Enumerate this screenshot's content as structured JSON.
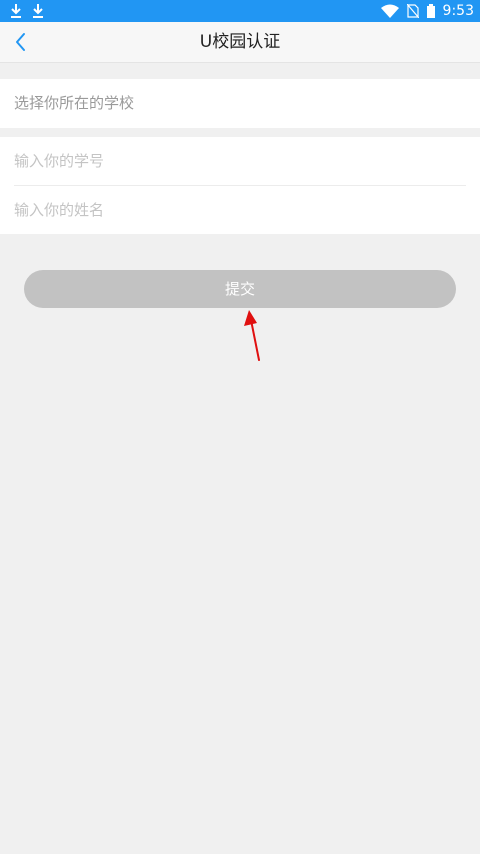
{
  "status_bar": {
    "time": "9:53",
    "background_color": "#2196f3",
    "left_icons": [
      "download-icon",
      "download-icon"
    ],
    "right_icons": [
      "wifi-icon",
      "no-sim-icon",
      "battery-icon"
    ]
  },
  "nav": {
    "back_icon": "chevron-left-icon",
    "title": "U校园认证"
  },
  "form": {
    "school_select_label": "选择你所在的学校",
    "student_id_placeholder": "输入你的学号",
    "student_id_value": "",
    "name_placeholder": "输入你的姓名",
    "name_value": ""
  },
  "submit": {
    "label": "提交",
    "color": "#c2c2c2"
  },
  "annotation": {
    "arrow_color": "#e01010",
    "icon": "red-arrow-icon"
  }
}
